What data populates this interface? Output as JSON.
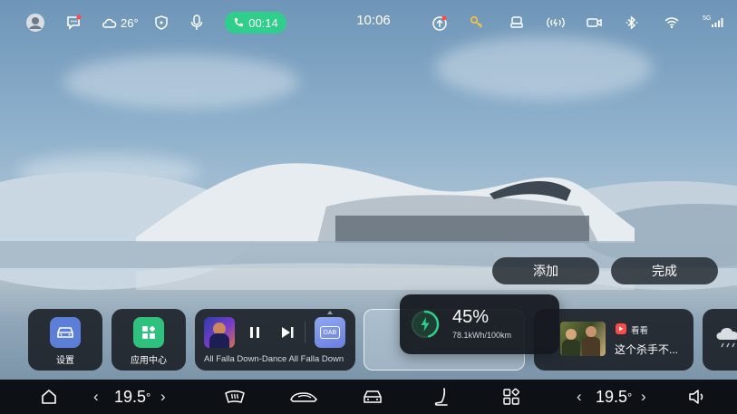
{
  "status_bar": {
    "weather_temp": "26°",
    "call_timer": "00:14",
    "clock": "10:06",
    "network": "5G"
  },
  "actions": {
    "add_label": "添加",
    "done_label": "完成"
  },
  "dock": {
    "settings_label": "设置",
    "app_center_label": "应用中心",
    "media": {
      "track": "All Falla Down-Dance All Falla Down",
      "source_badge": "DAB"
    },
    "energy": {
      "battery": "45%",
      "consumption": "78.1kWh/100km",
      "battery_level": 0.45
    },
    "video": {
      "app_name": "看看",
      "title": "这个杀手不..."
    }
  },
  "bottom_bar": {
    "left_temp": "19.5",
    "right_temp": "19.5",
    "degree": "°"
  },
  "colors": {
    "accent_green": "#2fcf8b",
    "notification_red": "#ff4a4a",
    "key_yellow": "#f5c542",
    "app_blue": "#5b7fd6",
    "app_green": "#2ec27e"
  }
}
